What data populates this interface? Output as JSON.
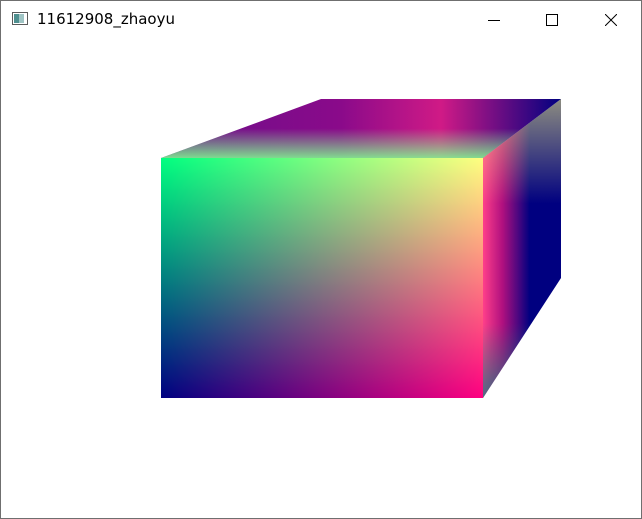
{
  "window": {
    "title": "11612908_zhaoyu"
  },
  "titlebar_buttons": {
    "minimize": "minimize-icon",
    "maximize": "maximize-icon",
    "close": "close-icon"
  },
  "scene": {
    "object": "cube",
    "background_color": "#ffffff",
    "vertex_colors": {
      "front_top_left": "#00ff80",
      "front_top_right": "#ffff80",
      "front_bottom_left": "#000080",
      "front_bottom_right": "#ff0080",
      "back_top_left": "#800080",
      "back_top_right": "#000080",
      "back_bottom_right": "#008080"
    }
  }
}
